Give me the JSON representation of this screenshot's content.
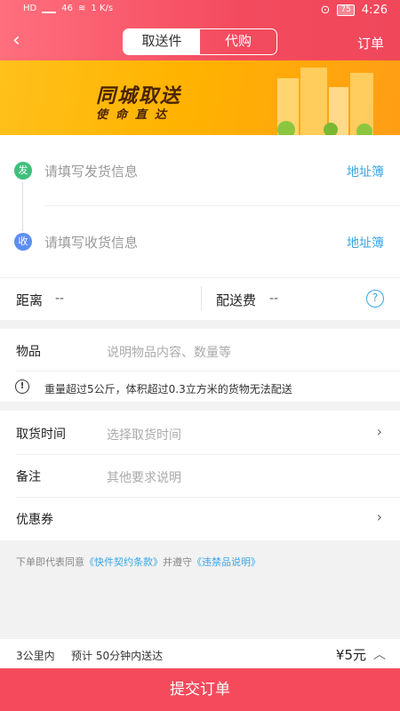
{
  "status_bar": {
    "left_items": [
      "HD",
      "4G",
      "46",
      "1 K/s"
    ],
    "battery": "75",
    "time": "4:26"
  },
  "header": {
    "back_icon": "back-arrow-icon",
    "tabs": [
      {
        "label": "取送件",
        "active": true
      },
      {
        "label": "代购",
        "active": false
      }
    ],
    "orders_label": "订单",
    "accent_color": "#f34a5e"
  },
  "banner": {
    "title": "同城取送",
    "subtitle": "使命直达"
  },
  "address": {
    "sender_badge": "发",
    "sender_placeholder": "请填写发货信息",
    "receiver_badge": "收",
    "receiver_placeholder": "请填写收货信息",
    "address_book_label": "地址簿"
  },
  "distance": {
    "distance_label": "距离",
    "distance_value": "--",
    "fee_label": "配送费",
    "fee_value": "--",
    "help_icon": "question-circle-icon"
  },
  "goods": {
    "label": "物品",
    "placeholder": "说明物品内容、数量等",
    "notice": "重量超过5公斤，体积超过0.3立方米的货物无法配送"
  },
  "details": {
    "pickup_label": "取货时间",
    "pickup_placeholder": "选择取货时间",
    "remark_label": "备注",
    "remark_placeholder": "其他要求说明",
    "coupon_label": "优惠券"
  },
  "agreement": {
    "prefix": "下单即代表同意",
    "terms": "《快件契约条款》",
    "middle": "并遵守",
    "prohibited": "《违禁品说明》"
  },
  "footer": {
    "range": "3公里内",
    "eta": "预计 50分钟内送达",
    "price": "¥5元",
    "submit_label": "提交订单"
  }
}
